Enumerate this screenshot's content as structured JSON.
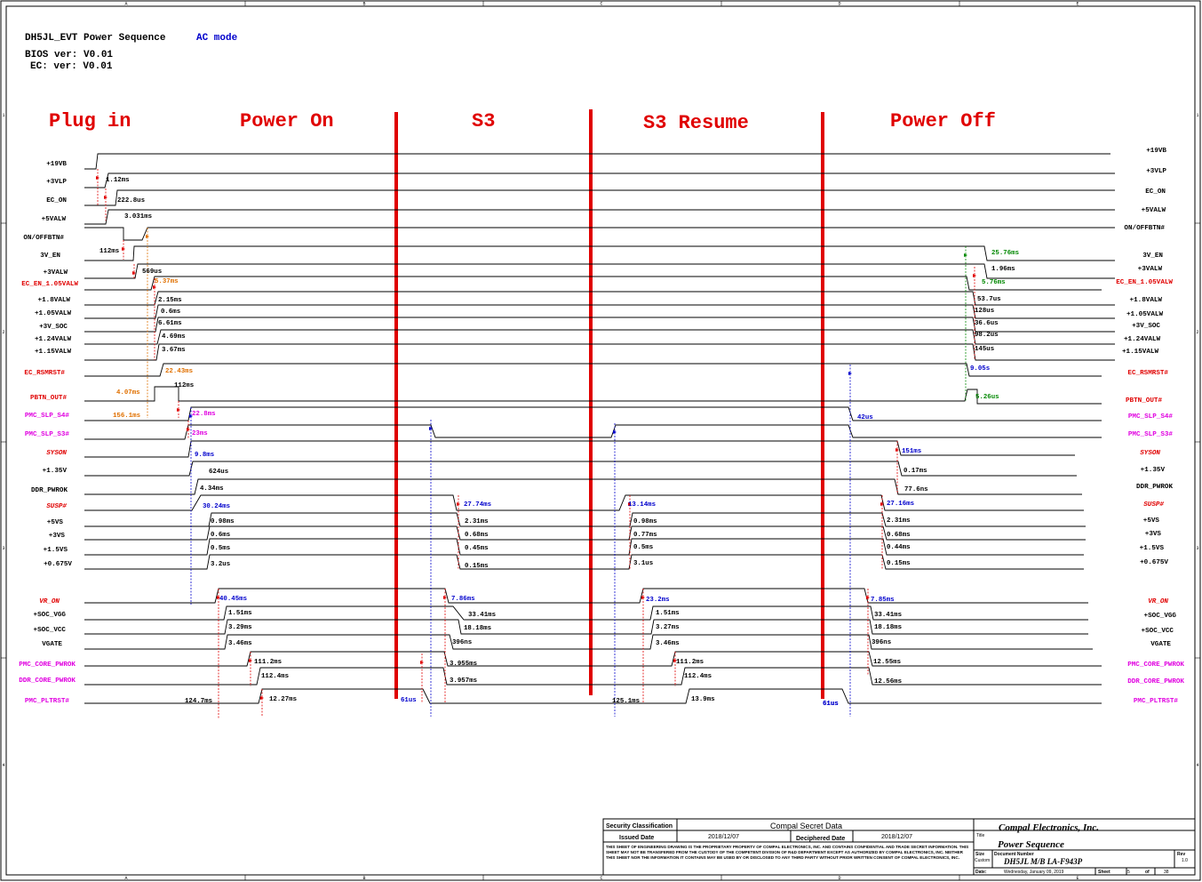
{
  "header": {
    "title": "DH5JL_EVT Power Sequence",
    "mode": "AC mode",
    "bios": "BIOS ver: V0.01",
    "ec": "EC: ver: V0.01"
  },
  "phases": [
    "Plug in",
    "Power On",
    "S3",
    "S3 Resume",
    "Power Off"
  ],
  "border": {
    "cols": [
      "A",
      "B",
      "C",
      "D",
      "E"
    ],
    "rows": [
      "1",
      "2",
      "3",
      "4"
    ]
  },
  "signals_left": [
    {
      "name": "+19VB",
      "color": "#000000"
    },
    {
      "name": "+3VLP",
      "color": "#000000"
    },
    {
      "name": "EC_ON",
      "color": "#000000"
    },
    {
      "name": "+5VALW",
      "color": "#000000"
    },
    {
      "name": "ON/OFFBTN#",
      "color": "#000000"
    },
    {
      "name": "3V_EN",
      "color": "#000000"
    },
    {
      "name": "+3VALW",
      "color": "#000000"
    },
    {
      "name": "EC_EN_1.05VALW",
      "color": "#e00000"
    },
    {
      "name": "+1.8VALW",
      "color": "#000000"
    },
    {
      "name": "+1.05VALW",
      "color": "#000000"
    },
    {
      "name": "+3V_SOC",
      "color": "#000000"
    },
    {
      "name": "+1.24VALW",
      "color": "#000000"
    },
    {
      "name": "+1.15VALW",
      "color": "#000000"
    },
    {
      "name": "EC_RSMRST#",
      "color": "#e00000"
    },
    {
      "name": "PBTN_OUT#",
      "color": "#e00000"
    },
    {
      "name": "PMC_SLP_S4#",
      "color": "#e000e0"
    },
    {
      "name": "PMC_SLP_S3#",
      "color": "#e000e0"
    },
    {
      "name": "SYSON",
      "color": "#e00000"
    },
    {
      "name": "+1.35V",
      "color": "#000000"
    },
    {
      "name": "DDR_PWROK",
      "color": "#000000"
    },
    {
      "name": "SUSP#",
      "color": "#e00000"
    },
    {
      "name": "+5VS",
      "color": "#000000"
    },
    {
      "name": "+3VS",
      "color": "#000000"
    },
    {
      "name": "+1.5VS",
      "color": "#000000"
    },
    {
      "name": "+0.675V",
      "color": "#000000"
    },
    {
      "name": "VR_ON",
      "color": "#e00000"
    },
    {
      "name": "+SOC_VGG",
      "color": "#000000"
    },
    {
      "name": "+SOC_VCC",
      "color": "#000000"
    },
    {
      "name": "VGATE",
      "color": "#000000"
    },
    {
      "name": "PMC_CORE_PWROK",
      "color": "#e000e0"
    },
    {
      "name": "DDR_CORE_PWROK",
      "color": "#e000e0"
    },
    {
      "name": "PMC_PLTRST#",
      "color": "#e000e0"
    }
  ],
  "signals_right": [
    {
      "name": "+19VB",
      "color": "#000000"
    },
    {
      "name": "+3VLP",
      "color": "#000000"
    },
    {
      "name": "EC_ON",
      "color": "#000000"
    },
    {
      "name": "+5VALW",
      "color": "#000000"
    },
    {
      "name": "ON/OFFBTN#",
      "color": "#000000"
    },
    {
      "name": "3V_EN",
      "color": "#000000"
    },
    {
      "name": "+3VALW",
      "color": "#000000"
    },
    {
      "name": "EC_EN_1.05VALW",
      "color": "#e00000"
    },
    {
      "name": "+1.8VALW",
      "color": "#000000"
    },
    {
      "name": "+1.05VALW",
      "color": "#000000"
    },
    {
      "name": "+3V_SOC",
      "color": "#000000"
    },
    {
      "name": "+1.24VALW",
      "color": "#000000"
    },
    {
      "name": "+1.15VALW",
      "color": "#000000"
    },
    {
      "name": "EC_RSMRST#",
      "color": "#e00000"
    },
    {
      "name": "PBTN_OUT#",
      "color": "#e00000"
    },
    {
      "name": "PMC_SLP_S4#",
      "color": "#e000e0"
    },
    {
      "name": "PMC_SLP_S3#",
      "color": "#e000e0"
    },
    {
      "name": "SYSON",
      "color": "#e00000"
    },
    {
      "name": "+1.35V",
      "color": "#000000"
    },
    {
      "name": "DDR_PWROK",
      "color": "#000000"
    },
    {
      "name": "SUSP#",
      "color": "#e00000"
    },
    {
      "name": "+5VS",
      "color": "#000000"
    },
    {
      "name": "+3VS",
      "color": "#000000"
    },
    {
      "name": "+1.5VS",
      "color": "#000000"
    },
    {
      "name": "+0.675V",
      "color": "#000000"
    },
    {
      "name": "VR_ON",
      "color": "#e00000"
    },
    {
      "name": "+SOC_VGG",
      "color": "#000000"
    },
    {
      "name": "+SOC_VCC",
      "color": "#000000"
    },
    {
      "name": "VGATE",
      "color": "#000000"
    },
    {
      "name": "PMC_CORE_PWROK",
      "color": "#e000e0"
    },
    {
      "name": "DDR_CORE_PWROK",
      "color": "#e000e0"
    },
    {
      "name": "PMC_PLTRST#",
      "color": "#e000e0"
    }
  ],
  "annotations": [
    {
      "t": "1.12ms",
      "c": "#000000"
    },
    {
      "t": "222.8us",
      "c": "#000000"
    },
    {
      "t": "3.031ms",
      "c": "#000000"
    },
    {
      "t": "112ms",
      "c": "#000000"
    },
    {
      "t": "569us",
      "c": "#000000"
    },
    {
      "t": "5.37ms",
      "c": "#e07000"
    },
    {
      "t": "2.15ms",
      "c": "#000000"
    },
    {
      "t": "0.6ms",
      "c": "#000000"
    },
    {
      "t": "6.61ms",
      "c": "#000000"
    },
    {
      "t": "4.69ms",
      "c": "#000000"
    },
    {
      "t": "3.67ms",
      "c": "#000000"
    },
    {
      "t": "22.43ms",
      "c": "#e07000"
    },
    {
      "t": "4.07ms",
      "c": "#e07000"
    },
    {
      "t": "112ms",
      "c": "#000000"
    },
    {
      "t": "156.1ms",
      "c": "#e07000"
    },
    {
      "t": "22.8ms",
      "c": "#e000e0"
    },
    {
      "t": "23ms",
      "c": "#e000e0"
    },
    {
      "t": "9.8ms",
      "c": "#0000cc"
    },
    {
      "t": "624us",
      "c": "#000000"
    },
    {
      "t": "4.34ms",
      "c": "#000000"
    },
    {
      "t": "30.24ms",
      "c": "#0000cc"
    },
    {
      "t": "0.98ms",
      "c": "#000000"
    },
    {
      "t": "0.6ms",
      "c": "#000000"
    },
    {
      "t": "0.5ms",
      "c": "#000000"
    },
    {
      "t": "3.2us",
      "c": "#000000"
    },
    {
      "t": "40.45ms",
      "c": "#0000cc"
    },
    {
      "t": "1.51ms",
      "c": "#000000"
    },
    {
      "t": "3.29ms",
      "c": "#000000"
    },
    {
      "t": "3.46ms",
      "c": "#000000"
    },
    {
      "t": "111.2ms",
      "c": "#000000"
    },
    {
      "t": "112.4ms",
      "c": "#000000"
    },
    {
      "t": "124.7ms",
      "c": "#000000"
    },
    {
      "t": "12.27ms",
      "c": "#000000"
    },
    {
      "t": "61us",
      "c": "#0000cc"
    },
    {
      "t": "27.74ms",
      "c": "#0000cc"
    },
    {
      "t": "2.31ms",
      "c": "#000000"
    },
    {
      "t": "0.68ms",
      "c": "#000000"
    },
    {
      "t": "0.45ms",
      "c": "#000000"
    },
    {
      "t": "0.15ms",
      "c": "#000000"
    },
    {
      "t": "7.86ms",
      "c": "#0000cc"
    },
    {
      "t": "33.41ms",
      "c": "#000000"
    },
    {
      "t": "18.18ms",
      "c": "#000000"
    },
    {
      "t": "396ns",
      "c": "#000000"
    },
    {
      "t": "3.955ms",
      "c": "#000000"
    },
    {
      "t": "3.957ms",
      "c": "#000000"
    },
    {
      "t": "13.14ms",
      "c": "#0000cc"
    },
    {
      "t": "0.98ms",
      "c": "#000000"
    },
    {
      "t": "0.77ms",
      "c": "#000000"
    },
    {
      "t": "0.5ms",
      "c": "#000000"
    },
    {
      "t": "3.1us",
      "c": "#000000"
    },
    {
      "t": "23.2ms",
      "c": "#0000cc"
    },
    {
      "t": "1.51ms",
      "c": "#000000"
    },
    {
      "t": "3.27ms",
      "c": "#000000"
    },
    {
      "t": "3.46ms",
      "c": "#000000"
    },
    {
      "t": "111.2ms",
      "c": "#000000"
    },
    {
      "t": "112.4ms",
      "c": "#000000"
    },
    {
      "t": "125.1ms",
      "c": "#000000"
    },
    {
      "t": "13.9ms",
      "c": "#000000"
    },
    {
      "t": "61us",
      "c": "#0000cc"
    },
    {
      "t": "25.76ms",
      "c": "#008800"
    },
    {
      "t": "1.96ms",
      "c": "#000000"
    },
    {
      "t": "5.76ms",
      "c": "#008800"
    },
    {
      "t": "53.7us",
      "c": "#000000"
    },
    {
      "t": "128us",
      "c": "#000000"
    },
    {
      "t": "36.6us",
      "c": "#000000"
    },
    {
      "t": "98.2us",
      "c": "#000000"
    },
    {
      "t": "145us",
      "c": "#000000"
    },
    {
      "t": "9.05s",
      "c": "#0000cc"
    },
    {
      "t": "5.26us",
      "c": "#008800"
    },
    {
      "t": "42us",
      "c": "#0000cc"
    },
    {
      "t": "151ms",
      "c": "#0000cc"
    },
    {
      "t": "0.17ms",
      "c": "#000000"
    },
    {
      "t": "77.6ns",
      "c": "#000000"
    },
    {
      "t": "27.16ms",
      "c": "#0000cc"
    },
    {
      "t": "2.31ms",
      "c": "#000000"
    },
    {
      "t": "0.68ms",
      "c": "#000000"
    },
    {
      "t": "0.44ms",
      "c": "#000000"
    },
    {
      "t": "0.15ms",
      "c": "#000000"
    },
    {
      "t": "7.85ms",
      "c": "#0000cc"
    },
    {
      "t": "33.41ms",
      "c": "#000000"
    },
    {
      "t": "18.18ms",
      "c": "#000000"
    },
    {
      "t": "396ns",
      "c": "#000000"
    },
    {
      "t": "12.55ms",
      "c": "#000000"
    },
    {
      "t": "12.56ms",
      "c": "#000000"
    },
    {
      "t": "61us",
      "c": "#0000cc"
    }
  ],
  "title_block": {
    "security_label": "Security Classification",
    "security_value": "Compal Secret Data",
    "issued_label": "Issued Date",
    "issued_value": "2018/12/07",
    "deciphered_label": "Deciphered Date",
    "deciphered_value": "2018/12/07",
    "notice": "THIS SHEET OF ENGINEERING DRAWING IS THE PROPRIETARY PROPERTY OF COMPAL ELECTRONICS, INC. AND CONTAINS CONFIDENTIAL AND TRADE SECRET INFORMATION. THIS SHEET MAY NOT BE TRANSFERED FROM THE CUSTODY OF THE COMPETENT DIVISION OF R&D DEPARTMENT EXCEPT AS AUTHORIZED BY COMPAL ELECTRONICS, INC. NEITHER THIS SHEET NOR THE INFORMATION IT CONTAINS MAY BE USED BY OR DISCLOSED TO ANY THIRD PARTY WITHOUT PRIOR WRITTEN CONSENT OF COMPAL ELECTRONICS, INC.",
    "company": "Compal Electronics, Inc.",
    "title_label": "Title",
    "title": "Power Sequence",
    "size_label": "Size",
    "size_value": "Custom",
    "docnum_label": "Document Number",
    "docnum": "DH5JL M/B LA-F943P",
    "rev_label": "Rev",
    "rev": "1.0",
    "date_label": "Date:",
    "date": "Wednesday, January 09, 2019",
    "sheet_label": "Sheet",
    "sheet": "5",
    "of_label": "of",
    "of": "38"
  }
}
